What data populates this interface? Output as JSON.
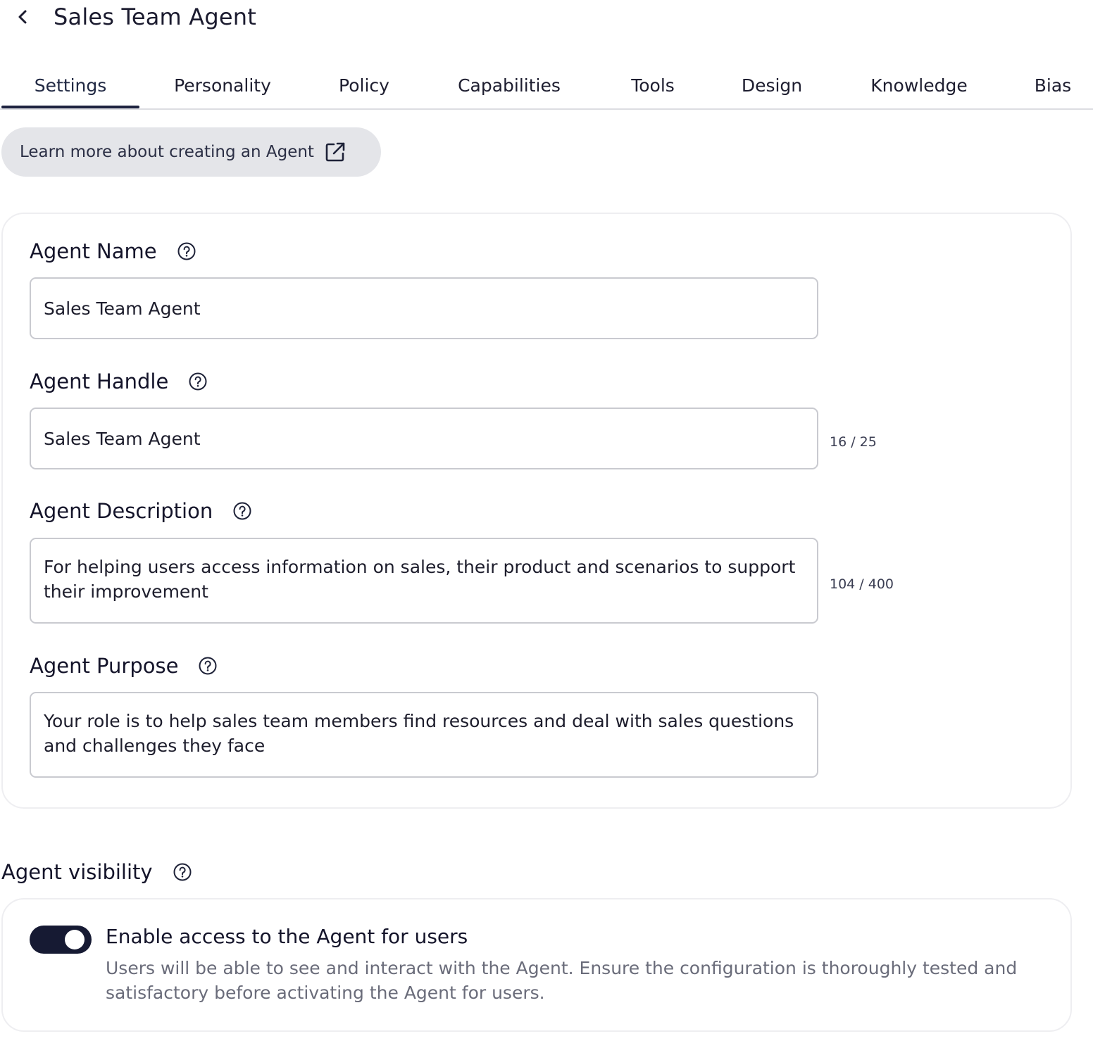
{
  "header": {
    "title": "Sales Team Agent",
    "back_icon": "chevron-left-icon"
  },
  "tabs": [
    {
      "label": "Settings",
      "active": true
    },
    {
      "label": "Personality",
      "active": false
    },
    {
      "label": "Policy",
      "active": false
    },
    {
      "label": "Capabilities",
      "active": false
    },
    {
      "label": "Tools",
      "active": false
    },
    {
      "label": "Design",
      "active": false
    },
    {
      "label": "Knowledge",
      "active": false
    },
    {
      "label": "Bias",
      "active": false
    }
  ],
  "learn_more": {
    "label": "Learn more about creating an Agent",
    "icon": "external-link-icon"
  },
  "form": {
    "agent_name": {
      "label": "Agent Name",
      "value": "Sales Team Agent"
    },
    "agent_handle": {
      "label": "Agent Handle",
      "value": "Sales Team Agent",
      "counter": "16 / 25"
    },
    "agent_description": {
      "label": "Agent Description",
      "value": "For helping users access information on sales, their product and scenarios to support their improvement",
      "counter": "104 / 400"
    },
    "agent_purpose": {
      "label": "Agent Purpose",
      "value": "Your role is to help sales team members find resources and deal with sales questions and challenges they face"
    }
  },
  "visibility": {
    "section_label": "Agent visibility",
    "toggle_on": true,
    "title": "Enable access to the Agent for users",
    "description": "Users will be able to see and interact with the Agent. Ensure the configuration is thoroughly tested and satisfactory before activating the Agent for users."
  },
  "colors": {
    "accent": "#161a33",
    "border": "#c9cad0",
    "pill_bg": "#e4e5e9",
    "muted_text": "#6a6c7a"
  }
}
